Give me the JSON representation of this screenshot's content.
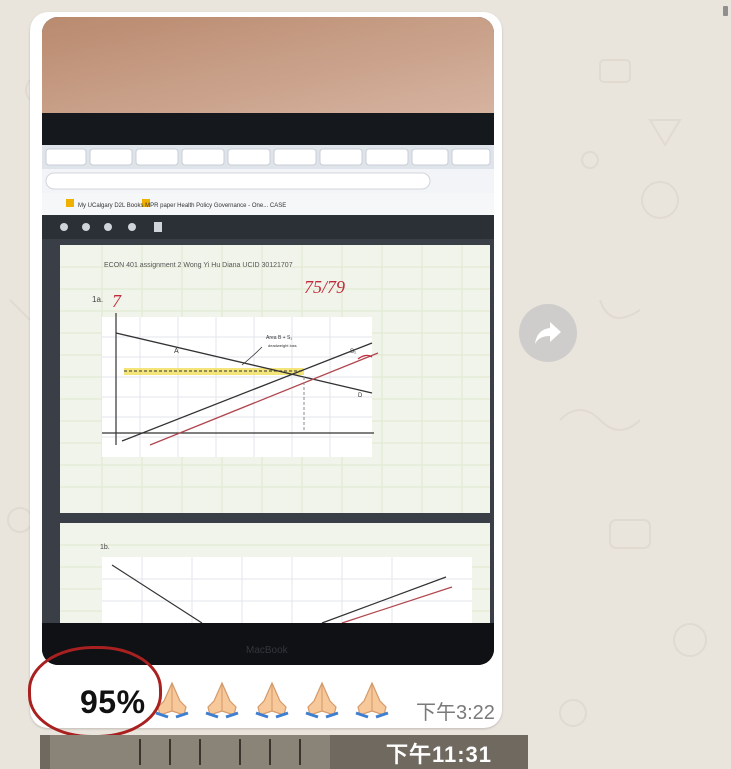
{
  "message": {
    "caption_percent": "95%",
    "emoji_count": 5,
    "emoji_icon": "folded-hands-icon",
    "timestamp": "下午3:22"
  },
  "photo": {
    "browser_bookmarks": [
      "My UCalgary",
      "D2L",
      "Books",
      "MPR",
      "paper",
      "Health Policy",
      "Governance - One...",
      "CASE"
    ],
    "doc_header": "ECON 401 assignment 2   Wong Yi Hu Diana   UCID 30121707",
    "grade": "75/79",
    "part_label": "1a.",
    "part_score": "7",
    "annotation_text": "Area B + S₁",
    "annotation_sub": "deadweight loss",
    "second_part_label": "1b."
  },
  "next_message": {
    "timestamp": "下午11:31"
  },
  "colors": {
    "annotation_circle": "#a82020",
    "bubble": "#ffffff",
    "wallpaper": "#e9e4dc"
  }
}
